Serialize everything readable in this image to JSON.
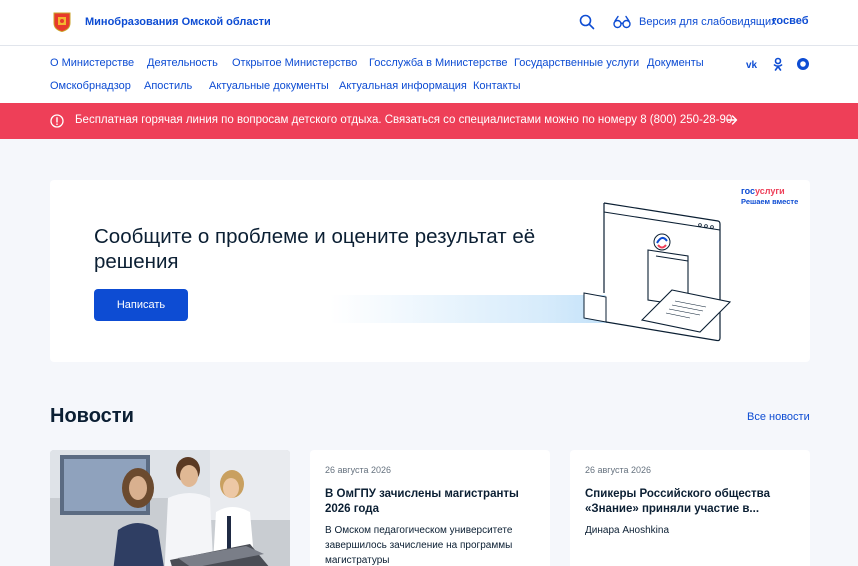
{
  "header": {
    "site_title": "Минобразования Омской области",
    "vision_link": "Версия для слабовидящих",
    "gosweb": "госвеб"
  },
  "nav": {
    "items": [
      "О Министерстве",
      "Деятельность",
      "Открытое Министерство",
      "Госслужба в Министерстве",
      "Государственные услуги",
      "Документы",
      "Омскобрнадзор",
      "Апостиль",
      "Актуальные документы",
      "Актуальная информация",
      "Контакты"
    ],
    "social_icons": [
      "vk-icon",
      "odnoklassniki-icon",
      "max-messenger-icon"
    ]
  },
  "hotline": {
    "text": "Бесплатная горячая линия по вопросам детского отдыха. Связаться со специалистами можно по номеру 8 (800) 250-28-90"
  },
  "banner": {
    "title": "Сообщите о проблеме и оцените результат её решения",
    "button": "Написать",
    "gos_logo_part1": "гос",
    "gos_logo_part2": "услуги",
    "gos_sub": "Решаем вместе"
  },
  "news": {
    "title": "Новости",
    "all_link": "Все новости",
    "cards": [
      {
        "date": "26 августа 2026",
        "title": "В ОмГПУ зачислены магистранты 2026 года",
        "text": "В Омском педагогическом университете завершилось зачисление на программы магистратуры"
      },
      {
        "date": "26 августа 2026",
        "title": "Спикеры Российского общества «Знание» приняли участие в...",
        "text": "Динара Аноshkina"
      }
    ]
  },
  "colors": {
    "primary": "#0d4cd3",
    "alert": "#ee3f58",
    "background": "#f5f7fb"
  }
}
